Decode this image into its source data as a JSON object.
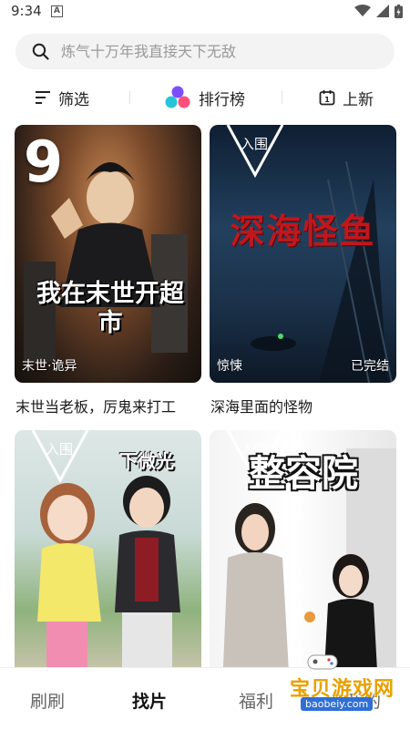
{
  "status_bar": {
    "time": "9:34",
    "notification_letter": "A"
  },
  "search": {
    "placeholder": "炼气十万年我直接天下无敌"
  },
  "filter_bar": {
    "filter_label": "筛选",
    "ranking_label": "排行榜",
    "new_label": "上新"
  },
  "cards": [
    {
      "title": "末世当老板，厉鬼来打工",
      "tag_left": "末世·诡异",
      "tag_right": "",
      "badge": "TOP 9",
      "poster_text": "我在末世开超市"
    },
    {
      "title": "深海里面的怪物",
      "tag_left": "惊悚",
      "tag_right": "已完结",
      "badge": "入围",
      "poster_text": "深海怪鱼"
    },
    {
      "title": "",
      "tag_left": "",
      "tag_right": "",
      "badge": "入围",
      "poster_text": "下微光"
    },
    {
      "title": "",
      "tag_left": "",
      "tag_right": "",
      "badge": "入围",
      "poster_text": "整容院"
    }
  ],
  "bottom_nav": [
    {
      "label": "刷刷",
      "active": false
    },
    {
      "label": "找片",
      "active": true
    },
    {
      "label": "福利",
      "active": false
    },
    {
      "label": "我的",
      "active": false
    }
  ],
  "watermark": {
    "text": "宝贝游戏网",
    "url": "baobeiy.com"
  },
  "colors": {
    "accent_red": "#c0171d",
    "search_bg": "#f3f3f3",
    "watermark_gold": "#e9a000"
  }
}
